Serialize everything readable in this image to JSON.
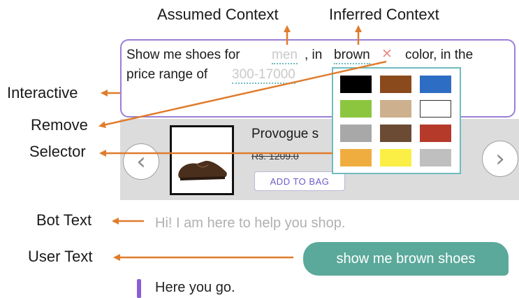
{
  "annotations": {
    "assumed_context": "Assumed Context",
    "inferred_context": "Inferred Context",
    "interactive": "Interactive",
    "remove": "Remove",
    "selector": "Selector",
    "bot_text": "Bot Text",
    "user_text": "User Text"
  },
  "query": {
    "part1": "Show me shoes for",
    "gender": "men",
    "part2": ", in",
    "color": "brown",
    "remove_glyph": "✕",
    "part3": "color, in the",
    "part4": "price range of",
    "price": "300-17000"
  },
  "product": {
    "title": "Provogue s",
    "price": "Rs. 1209.0",
    "add_to_bag": "ADD TO BAG",
    "prev_icon": "chevron-left-icon",
    "next_icon": "chevron-right-icon"
  },
  "selector_colors": [
    "#000000",
    "#8b4a1c",
    "#2d6dc3",
    "#8cc63f",
    "#cdb08e",
    "#ffffff",
    "#a8a8a8",
    "#6b4b33",
    "#b53a2a",
    "#f0ad3f",
    "#fbef45",
    "#bfbfbf"
  ],
  "chat": {
    "bot": "Hi! I am here to help you shop.",
    "user": "show me brown shoes",
    "reply": "Here you go."
  },
  "colors": {
    "arrow": "#e07c2c",
    "accent_purple": "#9a7fd6",
    "accent_teal": "#6fbcc0",
    "user_bubble": "#5aa99a"
  }
}
